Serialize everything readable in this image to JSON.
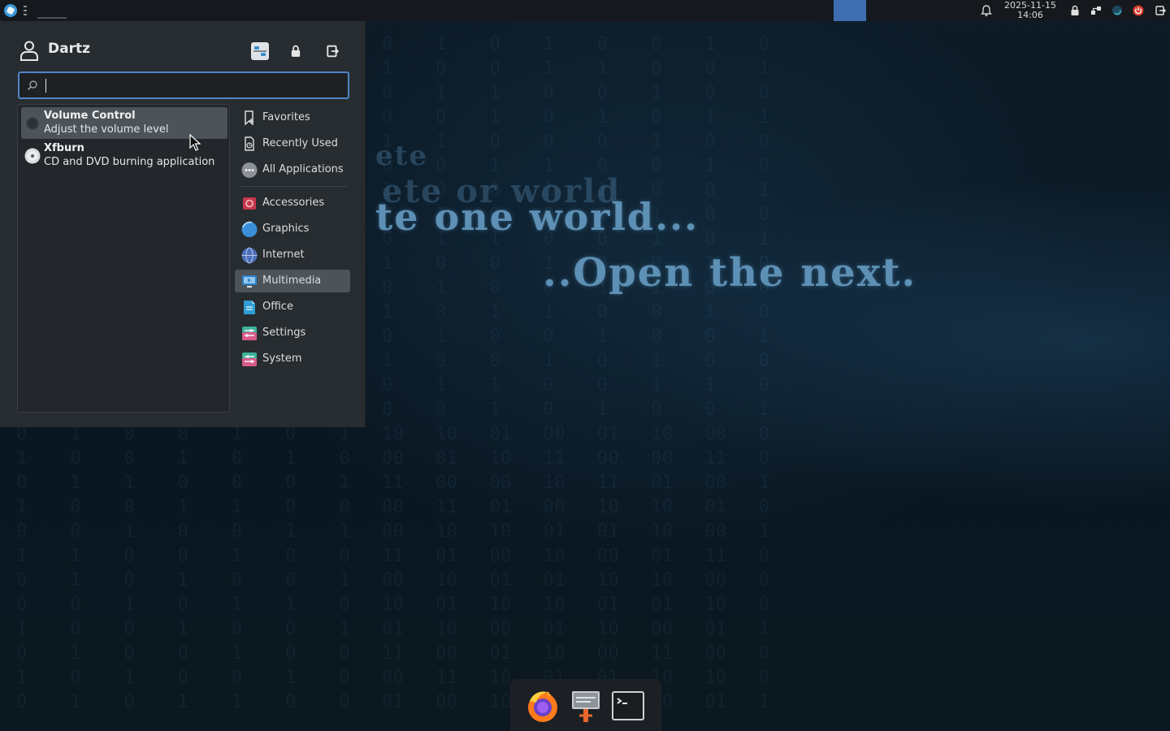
{
  "panel": {
    "clock_date": "2025-11-15",
    "clock_time": "14:06",
    "active_window_color": "#3f6eb0"
  },
  "wallpaper": {
    "line1": "te one world...",
    "line2": "..Open the next.",
    "faint1": "ete or  world",
    "faint2": "ete"
  },
  "menu": {
    "user_name": "Dartz",
    "search": {
      "value": "",
      "placeholder": ""
    },
    "header_buttons": [
      "settings-manager-icon",
      "lock-icon",
      "log-out-icon"
    ],
    "results": [
      {
        "title": "Volume Control",
        "description": "Adjust the volume level",
        "icon": "volume-control-icon",
        "selected": true
      },
      {
        "title": "Xfburn",
        "description": "CD and DVD burning application",
        "icon": "disc-icon",
        "selected": false
      }
    ],
    "categories": [
      {
        "label": "Favorites",
        "icon": "bookmark-icon"
      },
      {
        "label": "Recently Used",
        "icon": "recent-icon"
      },
      {
        "label": "All Applications",
        "icon": "all-apps-icon"
      },
      {
        "label": "Accessories",
        "icon": "accessories-icon"
      },
      {
        "label": "Graphics",
        "icon": "graphics-icon"
      },
      {
        "label": "Internet",
        "icon": "internet-icon"
      },
      {
        "label": "Multimedia",
        "icon": "multimedia-icon",
        "selected": true
      },
      {
        "label": "Office",
        "icon": "office-icon"
      },
      {
        "label": "Settings",
        "icon": "settings-icon"
      },
      {
        "label": "System",
        "icon": "system-icon"
      }
    ]
  },
  "dock": {
    "items": [
      "firefox-icon",
      "file-manager-icon",
      "terminal-icon"
    ]
  },
  "colors": {
    "accent": "#4f86c6",
    "selected_bg": "#4c5359",
    "menu_bg": "#272c30"
  }
}
